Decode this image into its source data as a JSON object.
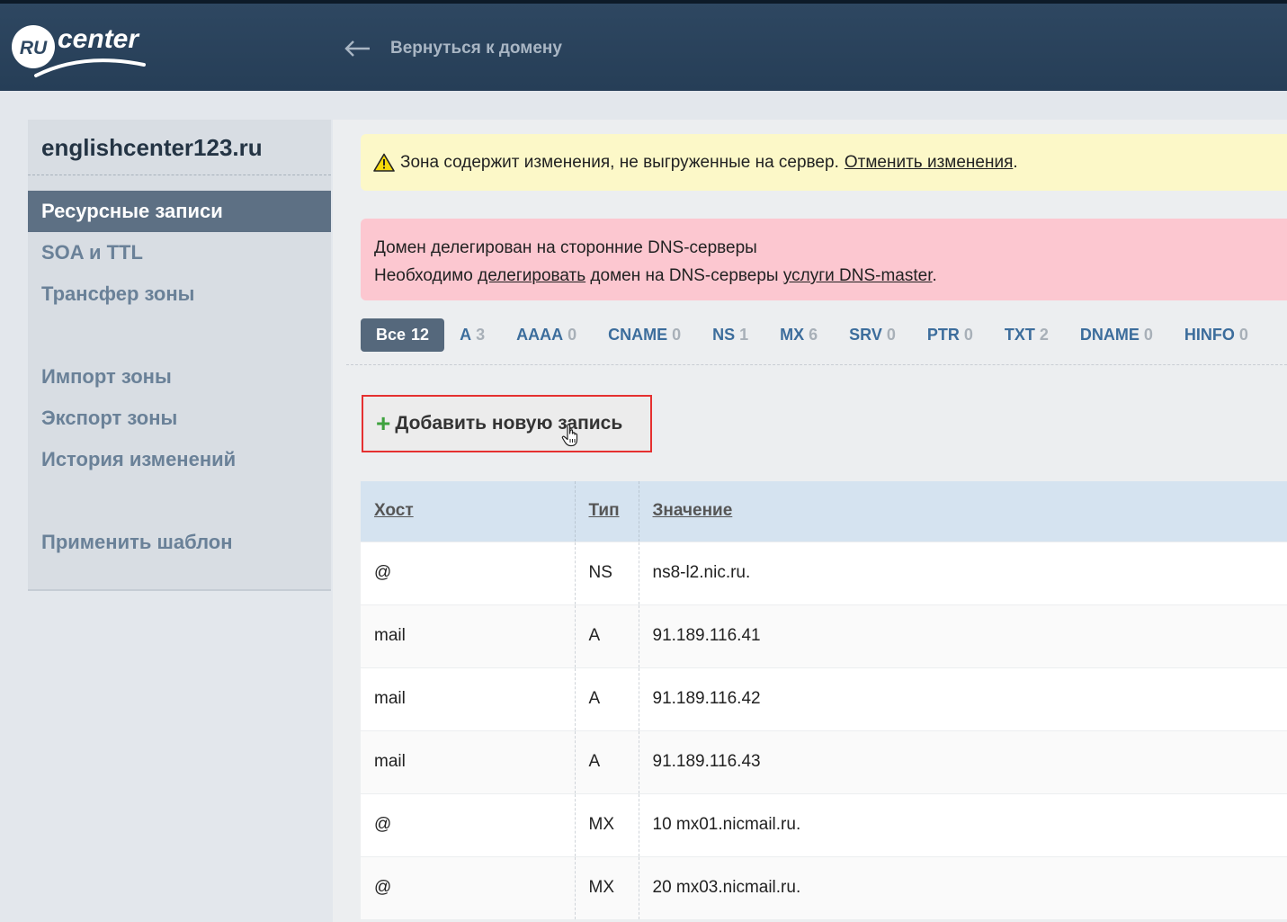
{
  "header": {
    "logo_text_ru": "RU",
    "logo_text_center": "center",
    "back_label": "Вернуться к домену"
  },
  "sidebar": {
    "domain": "englishcenter123.ru",
    "items": [
      {
        "label": "Ресурсные записи",
        "active": true
      },
      {
        "label": "SOA и TTL"
      },
      {
        "label": "Трансфер зоны"
      },
      {
        "label": "Импорт зоны"
      },
      {
        "label": "Экспорт зоны"
      },
      {
        "label": "История изменений"
      },
      {
        "label": "Применить шаблон"
      }
    ]
  },
  "warning": {
    "text": "Зона содержит изменения, не выгруженные на сервер.",
    "link": "Отменить изменения",
    "after": "."
  },
  "error": {
    "line1": "Домен делегирован на сторонние DNS-серверы",
    "line2_pre": "Необходимо",
    "line2_link": "делегировать",
    "line2_mid": "домен на DNS-серверы",
    "line2_link2": "услуги DNS-master",
    "line2_end": "."
  },
  "filters": [
    {
      "label": "Все",
      "count": "12"
    },
    {
      "label": "A",
      "count": "3"
    },
    {
      "label": "AAAA",
      "count": "0"
    },
    {
      "label": "CNAME",
      "count": "0"
    },
    {
      "label": "NS",
      "count": "1"
    },
    {
      "label": "MX",
      "count": "6"
    },
    {
      "label": "SRV",
      "count": "0"
    },
    {
      "label": "PTR",
      "count": "0"
    },
    {
      "label": "TXT",
      "count": "2"
    },
    {
      "label": "DNAME",
      "count": "0"
    },
    {
      "label": "HINFO",
      "count": "0"
    }
  ],
  "add_button": {
    "label": "Добавить новую запись"
  },
  "table": {
    "headers": [
      "Хост",
      "Тип",
      "Значение"
    ],
    "rows": [
      [
        "@",
        "NS",
        "ns8-l2.nic.ru."
      ],
      [
        "mail",
        "A",
        "91.189.116.41"
      ],
      [
        "mail",
        "A",
        "91.189.116.42"
      ],
      [
        "mail",
        "A",
        "91.189.116.43"
      ],
      [
        "@",
        "MX",
        "10 mx01.nicmail.ru."
      ],
      [
        "@",
        "MX",
        "20 mx03.nicmail.ru."
      ]
    ]
  },
  "colors": {
    "header_bg": "#2e4761",
    "accent_blue": "#3c6d9c",
    "warning_bg": "#fcf8c8",
    "error_bg": "#fcc7d0",
    "highlight_border": "#e53030"
  }
}
